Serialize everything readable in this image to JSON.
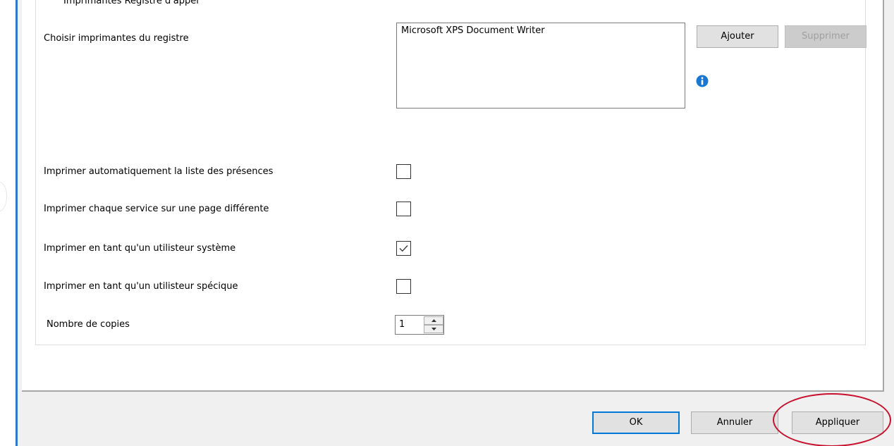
{
  "group": {
    "title": "Imprimantes Registre d'appel"
  },
  "printers": {
    "label": "Choisir imprimantes du registre",
    "items": [
      "Microsoft XPS Document Writer"
    ],
    "add_label": "Ajouter",
    "remove_label": "Supprimer"
  },
  "options": {
    "auto_print": {
      "label": "Imprimer automatiquement la liste des présences",
      "checked": false
    },
    "separate_pages": {
      "label": "Imprimer chaque service sur une page différente",
      "checked": false
    },
    "system_user": {
      "label": "Imprimer en tant qu'un utilisteur système",
      "checked": true
    },
    "specific_user": {
      "label": "Imprimer en tant qu'un utilisteur spécique",
      "checked": false
    }
  },
  "copies": {
    "label": "Nombre de copies",
    "value": "1"
  },
  "footer": {
    "ok_label": "OK",
    "cancel_label": "Annuler",
    "apply_label": "Appliquer"
  },
  "colors": {
    "accent": "#0078d7",
    "dialog_border": "#2b79c9",
    "info_icon": "#1976d2",
    "annotation": "#c8102e"
  }
}
